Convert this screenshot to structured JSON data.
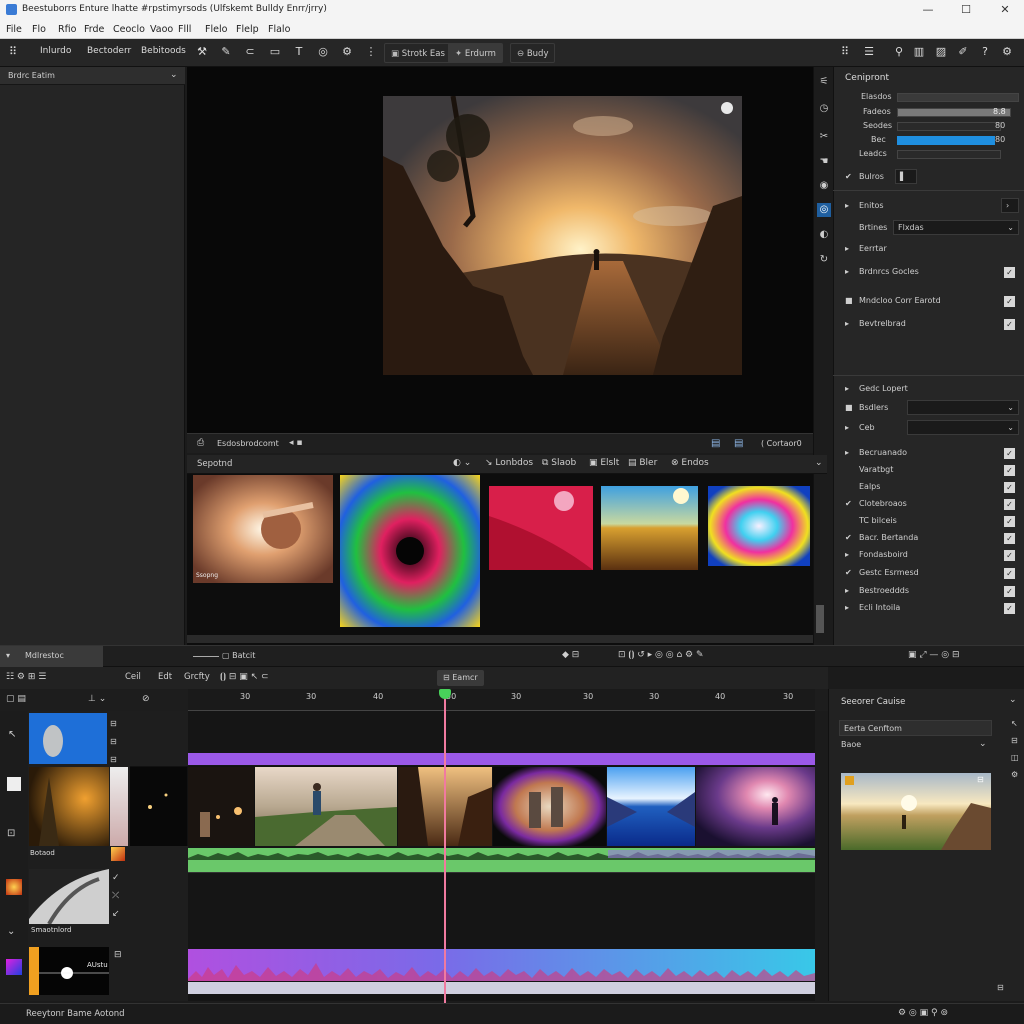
{
  "window": {
    "title": "Beestuborrs Enture lhatte #rpstimyrsods (Ulfskemt Bulldy Enrr/jrry)",
    "min_label": "—",
    "max_label": "☐",
    "close_label": "✕"
  },
  "menu": [
    "File",
    "Flo",
    "Rfio",
    "Frde",
    "Ceoclo",
    "Vaoo",
    "Flll",
    "Flelo",
    "Flelp",
    "Flalo"
  ],
  "toolbar": {
    "items": [
      "Inlurdo",
      "Bectoderr",
      "Bebitoods"
    ],
    "tabs": [
      "Strotk Eas",
      "Erdurm",
      "Budy"
    ]
  },
  "left_panel": {
    "header": "Brdrc Eatim"
  },
  "viewer": {
    "bar_label": "Esdosbrodcomt",
    "mode_label": "Cortaor0"
  },
  "media": {
    "tab_label": "Sepotnd",
    "buttons": [
      "Lonbdos",
      "Slaob",
      "Elslt",
      "Bler",
      "Endos"
    ],
    "thumb_caption": "Ssopng"
  },
  "right_panel": {
    "title": "Cenipront",
    "sliders": [
      {
        "label": "Elasdos",
        "value": "0"
      },
      {
        "label": "Fadeos",
        "value": "8.8"
      },
      {
        "label": "Seodes",
        "value": "80"
      },
      {
        "label": "Bec",
        "value": "80"
      },
      {
        "label": "Leadcs",
        "value": "0"
      }
    ],
    "section1": "Bulros",
    "section2": "Enitos",
    "dropdown1_label": "Brtines",
    "dropdown1_value": "Flxdas",
    "section3": "Eerrtar",
    "checks_a": [
      "Brdnrcs Gocles",
      "Mndcloo Corr Earotd",
      "Bevtrelbrad"
    ],
    "section4": "Gedc Lopert",
    "dropdown2_label": "Bsdlers",
    "dropdown3_label": "Ceb",
    "checks_b": [
      "Becruanado",
      "Varatbgt",
      "Ealps",
      "Clotebroaos",
      "TC bilceis",
      "Bacr. Bertanda",
      "Fondasboird",
      "Gestc Esrmesd",
      "Bestroeddds",
      "Ecli Intoila"
    ]
  },
  "timeline": {
    "top_label": "Mdlrestoc",
    "top_button": "Batcit",
    "tools": [
      "Ceil",
      "Edt",
      "Grcfty"
    ],
    "center_tab": "Eamcr",
    "ruler": [
      "30",
      "30",
      "40",
      "50",
      "30",
      "30",
      "30",
      "40",
      "30",
      "30"
    ],
    "track_labels": [
      "Botaod",
      "Smaotnlord",
      "AUstu"
    ],
    "inspector_title": "Seeorer Cauise",
    "inspector_field": "Eerta Cenftom",
    "inspector_dropdown": "Baoe"
  },
  "status": {
    "text": "Reeytonr Bame Aotond"
  },
  "colors": {
    "accent_blue": "#1f8fe0",
    "playhead": "#f07aa0",
    "playhead_handle": "#48d15a",
    "purple_track": "#9b59e8",
    "green_audio": "#6ac86a",
    "cyan_audio": "#38c8e8"
  }
}
